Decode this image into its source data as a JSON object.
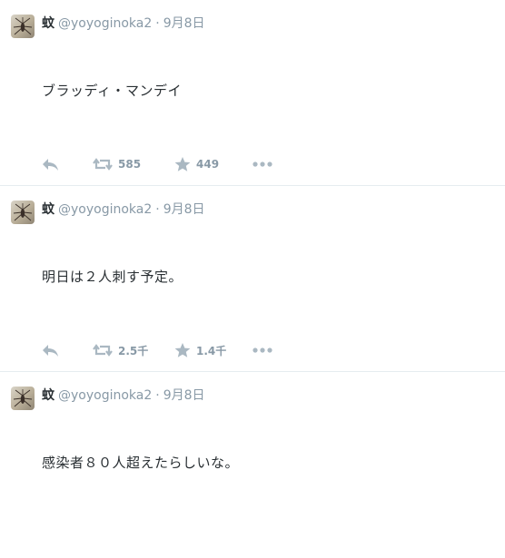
{
  "tweets": [
    {
      "name": "蚊",
      "handle": "@yoyoginoka2",
      "separator": "·",
      "time": "9月8日",
      "text": "ブラッディ・マンデイ",
      "retweets": "585",
      "favorites": "449"
    },
    {
      "name": "蚊",
      "handle": "@yoyoginoka2",
      "separator": "·",
      "time": "9月8日",
      "text": "明日は２人刺す予定。",
      "retweets": "2.5千",
      "favorites": "1.4千"
    },
    {
      "name": "蚊",
      "handle": "@yoyoginoka2",
      "separator": "·",
      "time": "9月8日",
      "text": "感染者８０人超えたらしいな。",
      "retweets": "",
      "favorites": ""
    }
  ],
  "colors": {
    "text": "#292f33",
    "muted": "#8899a6",
    "icon": "#aab8c2",
    "divider": "#e6ecf0"
  },
  "icons": [
    "reply-icon",
    "retweet-icon",
    "favorite-star-icon",
    "more-options-icon"
  ]
}
